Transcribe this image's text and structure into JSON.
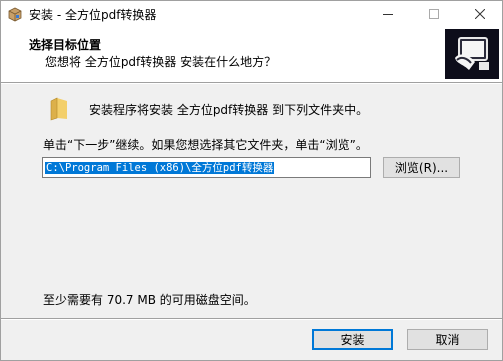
{
  "window": {
    "title": "安装 - 全方位pdf转换器",
    "icons": {
      "app": "installer-box-icon",
      "minimize": "minimize-icon",
      "maximize": "maximize-icon",
      "close": "close-icon"
    }
  },
  "header": {
    "title": "选择目标位置",
    "subtitle": "您想将 全方位pdf转换器 安装在什么地方？",
    "logo_icon": "computer-installer-icon"
  },
  "body": {
    "folder_icon": "folder-icon",
    "info": "安装程序将安装 全方位pdf转换器 到下列文件夹中。",
    "hint": "单击“下一步”继续。如果您想选择其它文件夹，单击“浏览”。",
    "path_value": "C:\\Program Files (x86)\\全方位pdf转换器",
    "browse_label": "浏览(R)...",
    "space_text": "至少需要有 70.7 MB 的可用磁盘空间。"
  },
  "footer": {
    "install_label": "安装",
    "cancel_label": "取消"
  },
  "colors": {
    "window_bg": "#f0f0f0",
    "header_bg": "#ffffff",
    "selection": "#0078d7",
    "logo_bg": "#0d0d1a"
  }
}
